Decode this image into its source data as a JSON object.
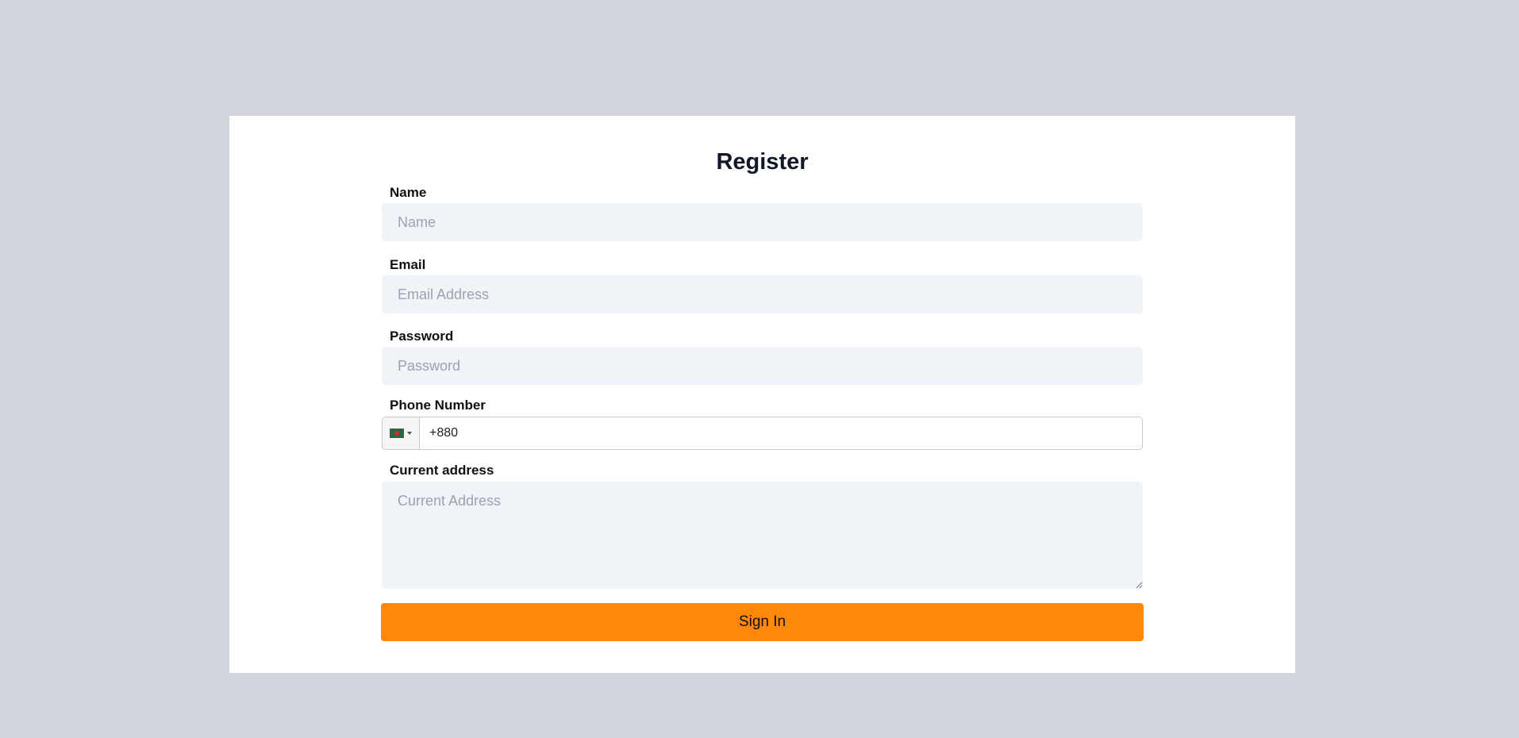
{
  "form": {
    "title": "Register",
    "name": {
      "label": "Name",
      "placeholder": "Name",
      "value": ""
    },
    "email": {
      "label": "Email",
      "placeholder": "Email Address",
      "value": ""
    },
    "password": {
      "label": "Password",
      "placeholder": "Password",
      "value": ""
    },
    "phone": {
      "label": "Phone Number",
      "value": "+880",
      "country_flag": "bangladesh-flag-icon"
    },
    "address": {
      "label": "Current address",
      "placeholder": "Current Address",
      "value": ""
    },
    "submit_label": "Sign In"
  },
  "colors": {
    "page_background": "#d1d5db",
    "card_background": "#ffffff",
    "input_background": "#f0f3f7",
    "submit_button": "#ff8709",
    "title": "#111827"
  }
}
